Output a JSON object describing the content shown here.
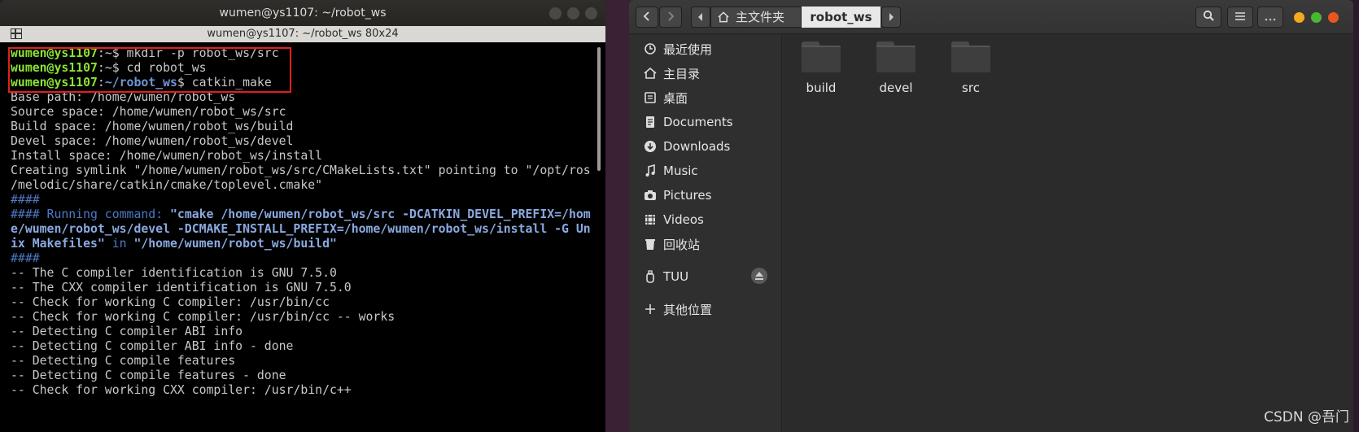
{
  "terminal": {
    "title": "wumen@ys1107: ~/robot_ws",
    "subtitle": "wumen@ys1107: ~/robot_ws 80x24",
    "prompt_user": "wumen@ys1107",
    "cmd1": "mkdir -p robot_ws/src",
    "cmd2": "cd robot_ws",
    "path3": "~/robot_ws",
    "cmd3": "catkin_make",
    "out": [
      "Base path: /home/wumen/robot_ws",
      "Source space: /home/wumen/robot_ws/src",
      "Build space: /home/wumen/robot_ws/build",
      "Devel space: /home/wumen/robot_ws/devel",
      "Install space: /home/wumen/robot_ws/install",
      "Creating symlink \"/home/wumen/robot_ws/src/CMakeLists.txt\" pointing to \"/opt/ros",
      "/melodic/share/catkin/cmake/toplevel.cmake\""
    ],
    "hash": "####",
    "run_label": "#### Running command: ",
    "run_cmd1": "\"cmake /home/wumen/robot_ws/src -DCATKIN_DEVEL_PREFIX=/hom",
    "run_cmd2": "e/wumen/robot_ws/devel -DCMAKE_INSTALL_PREFIX=/home/wumen/robot_ws/install -G Un",
    "run_cmd3": "ix Makefiles\"",
    "run_in": " in ",
    "run_dir": "\"/home/wumen/robot_ws/build\"",
    "cmake_out": [
      "-- The C compiler identification is GNU 7.5.0",
      "-- The CXX compiler identification is GNU 7.5.0",
      "-- Check for working C compiler: /usr/bin/cc",
      "-- Check for working C compiler: /usr/bin/cc -- works",
      "-- Detecting C compiler ABI info",
      "-- Detecting C compiler ABI info - done",
      "-- Detecting C compile features",
      "-- Detecting C compile features - done",
      "-- Check for working CXX compiler: /usr/bin/c++"
    ]
  },
  "files": {
    "breadcrumb_home": "主文件夹",
    "breadcrumb_current": "robot_ws",
    "sidebar": [
      {
        "label": "最近使用",
        "icon": "clock-icon"
      },
      {
        "label": "主目录",
        "icon": "home-icon"
      },
      {
        "label": "桌面",
        "icon": "desktop-icon"
      },
      {
        "label": "Documents",
        "icon": "document-icon"
      },
      {
        "label": "Downloads",
        "icon": "download-icon"
      },
      {
        "label": "Music",
        "icon": "music-icon"
      },
      {
        "label": "Pictures",
        "icon": "camera-icon"
      },
      {
        "label": "Videos",
        "icon": "video-icon"
      },
      {
        "label": "回收站",
        "icon": "trash-icon"
      },
      {
        "label": "TUU",
        "icon": "usb-drive-icon"
      },
      {
        "label": "其他位置",
        "icon": "plus-icon"
      }
    ],
    "folders": [
      "build",
      "devel",
      "src"
    ]
  },
  "watermark": "CSDN @吾门",
  "colors": {
    "prompt_user": "#8ae234",
    "prompt_path": "#6f95d6",
    "highlight_box": "#e0201d",
    "accent_close": "#e95420"
  }
}
